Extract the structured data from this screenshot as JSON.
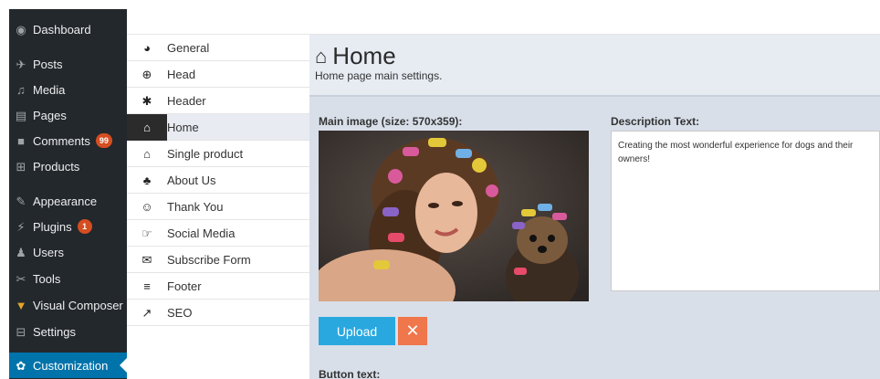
{
  "wp_menu": {
    "items": [
      {
        "icon": "dashboard-icon",
        "glyph": "◉",
        "label": "Dashboard"
      },
      {
        "icon": "pin-icon",
        "glyph": "✈",
        "label": "Posts"
      },
      {
        "icon": "media-icon",
        "glyph": "♫",
        "label": "Media"
      },
      {
        "icon": "pages-icon",
        "glyph": "▤",
        "label": "Pages"
      },
      {
        "icon": "comment-icon",
        "glyph": "■",
        "label": "Comments",
        "badge": "99"
      },
      {
        "icon": "cart-icon",
        "glyph": "⊞",
        "label": "Products"
      },
      {
        "icon": "brush-icon",
        "glyph": "✎",
        "label": "Appearance"
      },
      {
        "icon": "plugin-icon",
        "glyph": "⚡",
        "label": "Plugins",
        "badge": "1"
      },
      {
        "icon": "users-icon",
        "glyph": "♟",
        "label": "Users"
      },
      {
        "icon": "wrench-icon",
        "glyph": "✂",
        "label": "Tools"
      },
      {
        "icon": "visual-composer-icon",
        "glyph": "▼",
        "label": "Visual Composer"
      },
      {
        "icon": "settings-icon",
        "glyph": "⊟",
        "label": "Settings"
      },
      {
        "icon": "gear-icon",
        "glyph": "✿",
        "label": "Customization",
        "active": true
      }
    ]
  },
  "options_nav": {
    "items": [
      {
        "icon": "dashboard-gauge-icon",
        "glyph": "◕",
        "label": "General"
      },
      {
        "icon": "lifebuoy-icon",
        "glyph": "⊕",
        "label": "Head"
      },
      {
        "icon": "cog-icon",
        "glyph": "✱",
        "label": "Header"
      },
      {
        "icon": "home-icon",
        "glyph": "⌂",
        "label": "Home",
        "active": true
      },
      {
        "icon": "home-icon",
        "glyph": "⌂",
        "label": "Single product"
      },
      {
        "icon": "group-icon",
        "glyph": "♣",
        "label": "About Us"
      },
      {
        "icon": "smile-icon",
        "glyph": "☺",
        "label": "Thank You"
      },
      {
        "icon": "thumbs-up-icon",
        "glyph": "☞",
        "label": "Social Media"
      },
      {
        "icon": "envelope-icon",
        "glyph": "✉",
        "label": "Subscribe Form"
      },
      {
        "icon": "menu-lines-icon",
        "glyph": "≡",
        "label": "Footer"
      },
      {
        "icon": "line-chart-icon",
        "glyph": "↗",
        "label": "SEO"
      }
    ]
  },
  "page": {
    "title": "Home",
    "subtitle": "Home page main settings.",
    "main_image_label": "Main image (size: 570x359):",
    "description_label": "Description Text:",
    "description_value": "Creating the most wonderful experience for dogs and their owners!",
    "upload_label": "Upload",
    "remove_label": "✕",
    "button_text_label": "Button text:"
  },
  "colors": {
    "sidebar_bg": "#23282d",
    "sidebar_active": "#0073aa",
    "badge": "#d54e21",
    "upload_button": "#29a8e0",
    "remove_button": "#f0764b"
  }
}
